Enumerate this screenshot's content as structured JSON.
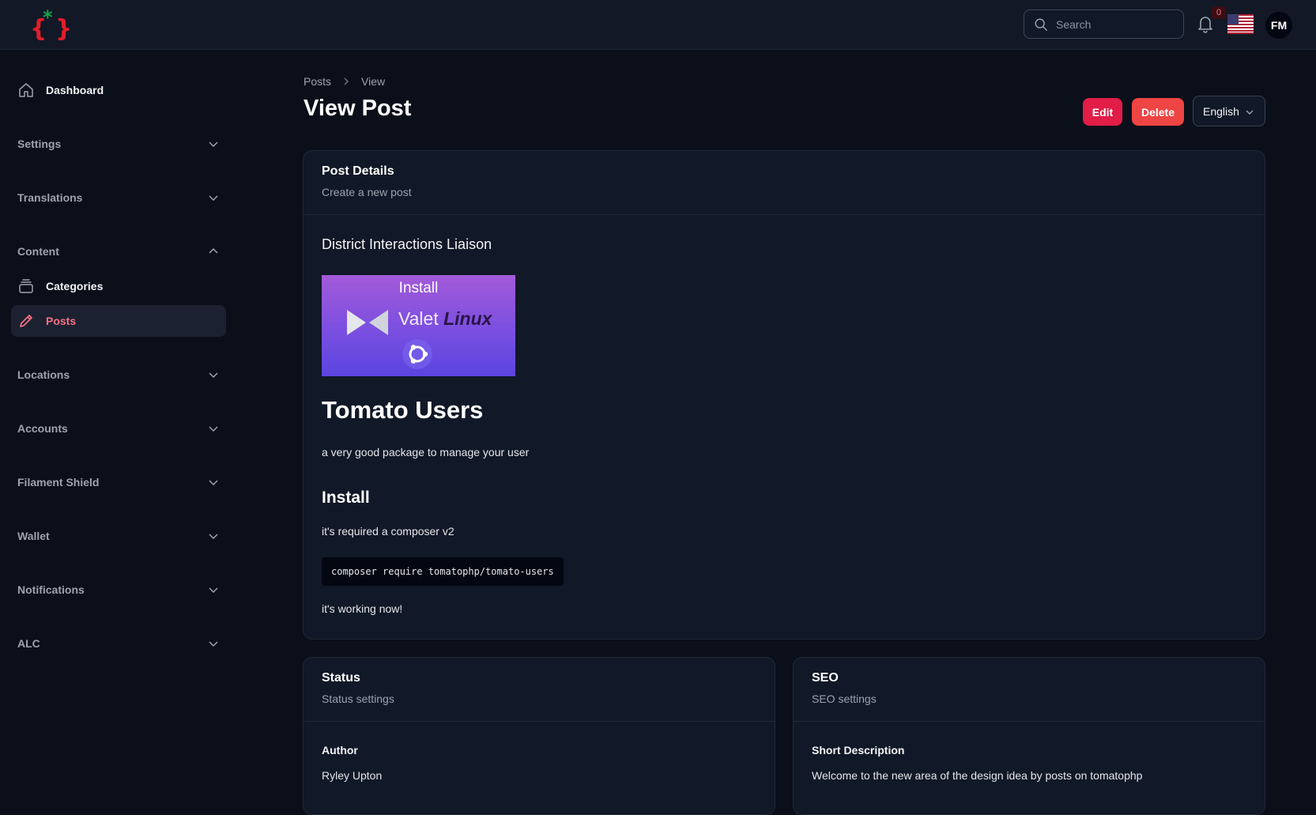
{
  "topbar": {
    "search_placeholder": "Search",
    "notification_count": "0",
    "avatar_initials": "FM"
  },
  "sidebar": {
    "dashboard": "Dashboard",
    "groups": {
      "settings": "Settings",
      "translations": "Translations",
      "content": "Content",
      "locations": "Locations",
      "accounts": "Accounts",
      "filament_shield": "Filament Shield",
      "wallet": "Wallet",
      "notifications": "Notifications",
      "alc": "ALC"
    },
    "content_items": {
      "categories": "Categories",
      "posts": "Posts"
    }
  },
  "header": {
    "breadcrumb": [
      "Posts",
      "View"
    ],
    "title": "View Post",
    "edit_label": "Edit",
    "delete_label": "Delete",
    "language": "English"
  },
  "post_details": {
    "title": "Post Details",
    "subtitle": "Create a new post",
    "post_subtitle": "District Interactions Liaison",
    "image": {
      "line1": "Install",
      "line2_a": "Valet",
      "line2_b": "Linux"
    },
    "heading": "Tomato Users",
    "intro": "a very good package to manage your user",
    "install_heading": "Install",
    "install_text": "it's required a composer v2",
    "code": "composer require tomatophp/tomato-users",
    "outro": "it's working now!"
  },
  "status": {
    "title": "Status",
    "subtitle": "Status settings",
    "author_label": "Author",
    "author_value": "Ryley Upton"
  },
  "seo": {
    "title": "SEO",
    "subtitle": "SEO settings",
    "short_desc_label": "Short Description",
    "short_desc_value": "Welcome to the new area of the design idea by posts on tomatophp"
  },
  "colors": {
    "accent": "#e11d48",
    "danger": "#ef4444",
    "background": "#0b0f1a",
    "card": "#111827"
  }
}
